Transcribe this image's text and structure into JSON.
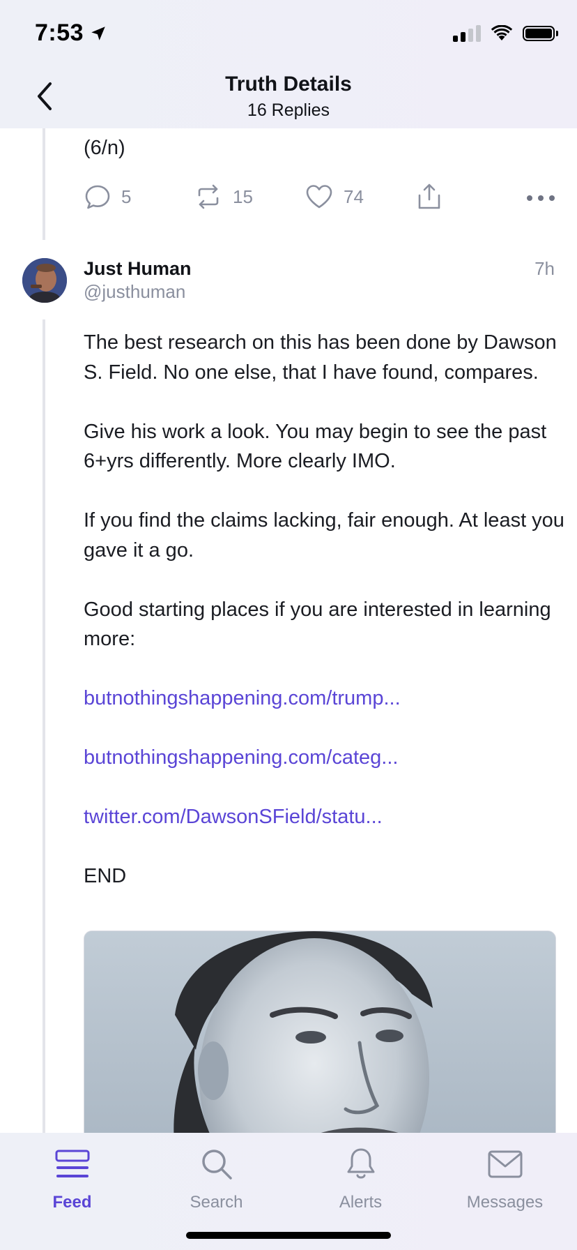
{
  "status_bar": {
    "time": "7:53"
  },
  "header": {
    "title": "Truth Details",
    "subtitle": "16 Replies"
  },
  "previous_post": {
    "text_tail": "(6/n)",
    "replies": "5",
    "retruths": "15",
    "likes": "74"
  },
  "post": {
    "author_name": "Just Human",
    "author_handle": "@justhuman",
    "time_ago": "7h",
    "paragraphs": [
      "The best research on this has been done by Dawson S. Field. No one else, that I have found, compares.",
      "Give his work a look. You may begin to see the past 6+yrs differently. More clearly IMO.",
      "If you find the claims lacking, fair enough. At least you gave it a go.",
      "Good starting places if you are interested in learning more:"
    ],
    "links": [
      "butnothingshappening.com/trump...",
      "butnothingshappening.com/categ...",
      "twitter.com/DawsonSField/statu..."
    ],
    "closing": "END"
  },
  "tabs": [
    {
      "label": "Feed",
      "icon": "feed-icon",
      "active": true
    },
    {
      "label": "Search",
      "icon": "search-icon",
      "active": false
    },
    {
      "label": "Alerts",
      "icon": "bell-icon",
      "active": false
    },
    {
      "label": "Messages",
      "icon": "mail-icon",
      "active": false
    }
  ],
  "colors": {
    "accent": "#5a45d6",
    "muted": "#8a8f9e",
    "text": "#111318",
    "bar_bg": "#eef0f7"
  }
}
